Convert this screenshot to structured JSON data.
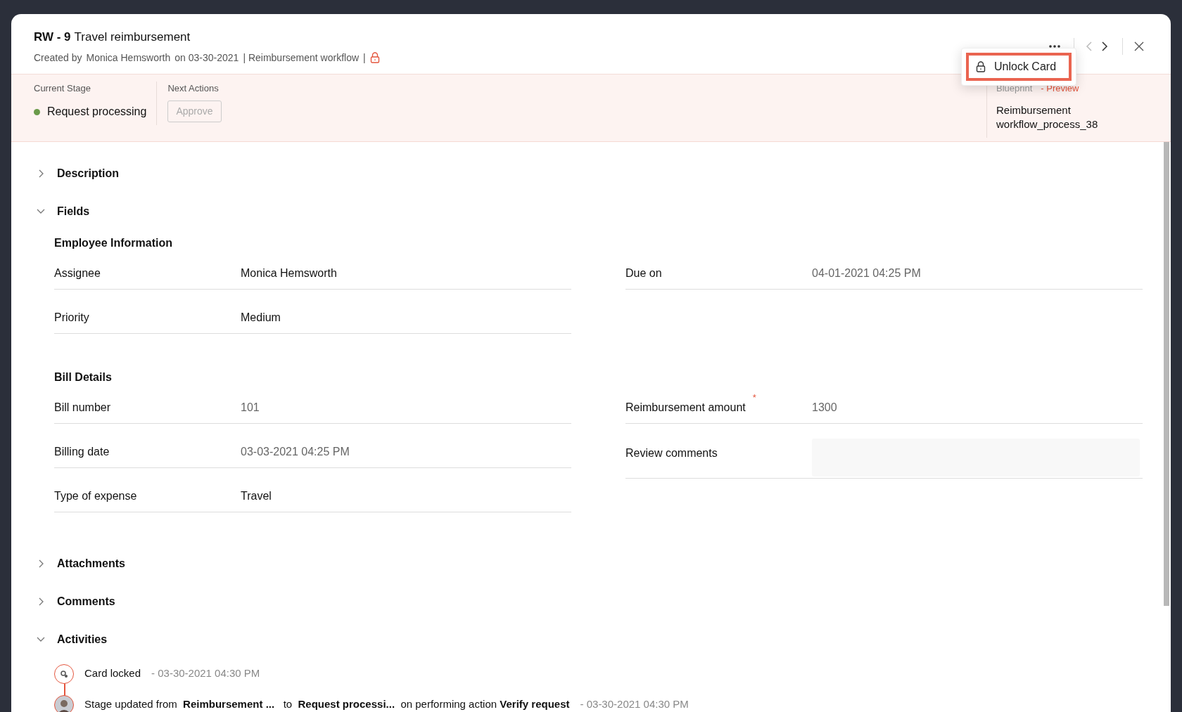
{
  "card": {
    "key": "RW - 9",
    "title": "Travel reimbursement",
    "meta": [
      "Created by",
      "Monica Hemsworth",
      "on 03-30-2021",
      "| Reimbursement workflow",
      "|"
    ],
    "locked": true
  },
  "menu": {
    "items": [
      {
        "label": "Unlock Card",
        "selected": true
      }
    ]
  },
  "stage_bar": {
    "current_stage_label": "Current Stage",
    "current_stage": "Request processing",
    "next_actions_label": "Next Actions",
    "actions": [
      {
        "label": "Approve",
        "disabled": true
      }
    ],
    "blueprint_label": "Blueprint",
    "preview_label": "- Preview",
    "blueprint": "Reimbursement workflow_process_38"
  },
  "sections": [
    {
      "title": "Description",
      "expanded": false
    },
    {
      "title": "Fields",
      "expanded": true,
      "groups": [
        {
          "title": "Employee Information",
          "columns": [
            {
              "fields": [
                {
                  "label": "Assignee",
                  "value": "Monica Hemsworth",
                  "readonly": false,
                  "kind": "text"
                },
                {
                  "label": "Priority",
                  "value": "Medium",
                  "readonly": false,
                  "kind": "text"
                }
              ]
            },
            {
              "fields": [
                {
                  "label": "Due on",
                  "value": "04-01-2021 04:25 PM",
                  "readonly": true,
                  "kind": "text"
                }
              ]
            }
          ]
        },
        {
          "title": "Bill Details",
          "columns": [
            {
              "fields": [
                {
                  "label": "Bill number",
                  "value": "101",
                  "readonly": true,
                  "kind": "text"
                },
                {
                  "label": "Billing date",
                  "value": "03-03-2021 04:25 PM",
                  "readonly": true,
                  "kind": "text"
                },
                {
                  "label": "Type of expense",
                  "value": "Travel",
                  "readonly": false,
                  "kind": "text"
                }
              ]
            },
            {
              "fields": [
                {
                  "label": "Reimbursement amount",
                  "value": "1300",
                  "readonly": true,
                  "required_mark": "*",
                  "kind": "text"
                },
                {
                  "label": "Review comments",
                  "kind": "textarea"
                }
              ]
            }
          ]
        }
      ]
    },
    {
      "title": "Attachments",
      "expanded": false
    },
    {
      "title": "Comments",
      "expanded": false
    },
    {
      "title": "Activities",
      "expanded": true,
      "activities": [
        {
          "kind": "lock",
          "text": "Card locked",
          "time": "- 03-30-2021 04:30 PM"
        },
        {
          "kind": "user",
          "text": "Stage updated from  **Reimbursement ...**   to  **Request processi...**  on performing action **Verify request**",
          "time": "- 03-30-2021 04:30 PM"
        }
      ]
    }
  ]
}
